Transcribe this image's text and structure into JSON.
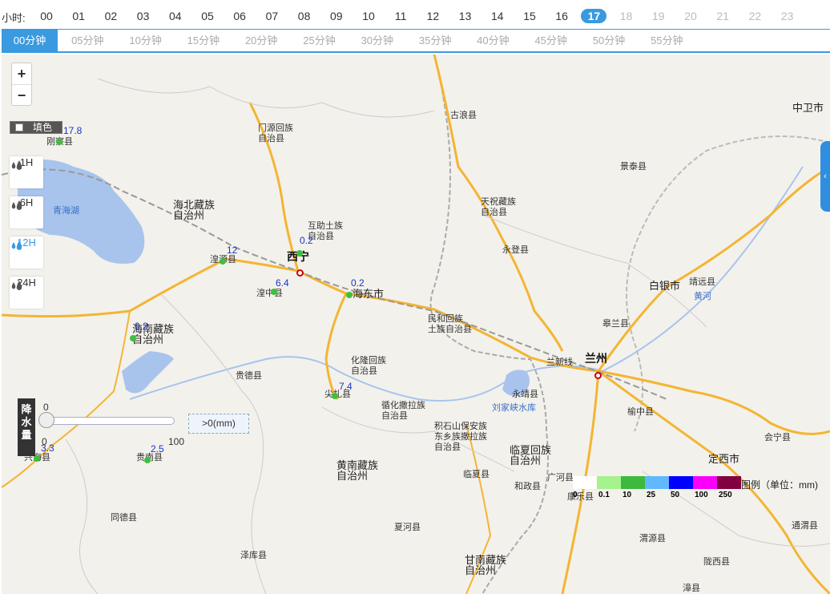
{
  "hour_bar": {
    "label": "小时:",
    "hours": [
      "00",
      "01",
      "02",
      "03",
      "04",
      "05",
      "06",
      "07",
      "08",
      "09",
      "10",
      "11",
      "12",
      "13",
      "14",
      "15",
      "16",
      "17",
      "18",
      "19",
      "20",
      "21",
      "22",
      "23"
    ],
    "active_hour": "17"
  },
  "minute_bar": {
    "minutes": [
      "00分钟",
      "05分钟",
      "10分钟",
      "15分钟",
      "20分钟",
      "25分钟",
      "30分钟",
      "35分钟",
      "40分钟",
      "45分钟",
      "50分钟",
      "55分钟"
    ],
    "active_minute": "00分钟"
  },
  "zoom": {
    "in": "+",
    "out": "−"
  },
  "fill_toggle": {
    "label": "填色",
    "checked": false
  },
  "periods": [
    {
      "label": "1H",
      "active": false
    },
    {
      "label": "6H",
      "active": false
    },
    {
      "label": "12H",
      "active": true
    },
    {
      "label": "24H",
      "active": false
    }
  ],
  "precip_slider": {
    "title": "降水量",
    "min_label": "0",
    "zero_label": "0",
    "max_label": "100",
    "readout": ">0(mm)",
    "value_fraction": 0
  },
  "legend": {
    "title": "图例（单位：mm)",
    "stops": [
      {
        "label": "0",
        "color": "#ffffff"
      },
      {
        "label": "0.1",
        "color": "#a6f28f"
      },
      {
        "label": "10",
        "color": "#3dba3d"
      },
      {
        "label": "25",
        "color": "#61b8ff"
      },
      {
        "label": "50",
        "color": "#0000ff"
      },
      {
        "label": "100",
        "color": "#fa00fa"
      },
      {
        "label": "250",
        "color": "#800040"
      }
    ]
  },
  "map": {
    "lake_label": "青海湖",
    "places": [
      {
        "name": "古浪县",
        "cls": "place"
      },
      {
        "name": "中卫市",
        "cls": "place big"
      },
      {
        "name": "门源回族\n自治县",
        "cls": "place"
      },
      {
        "name": "景泰县",
        "cls": "place"
      },
      {
        "name": "刚察县",
        "cls": "place"
      },
      {
        "name": "天祝藏族\n自治县",
        "cls": "place"
      },
      {
        "name": "海北藏族\n自治州",
        "cls": "place big"
      },
      {
        "name": "互助土族\n自治县",
        "cls": "place"
      },
      {
        "name": "永登县",
        "cls": "place"
      },
      {
        "name": "西宁",
        "cls": "place city"
      },
      {
        "name": "湟源县",
        "cls": "place"
      },
      {
        "name": "白银市",
        "cls": "place big"
      },
      {
        "name": "靖远县",
        "cls": "place"
      },
      {
        "name": "湟中县",
        "cls": "place"
      },
      {
        "name": "海东市",
        "cls": "place big"
      },
      {
        "name": "黄河",
        "cls": "place water"
      },
      {
        "name": "民和回族\n土族自治县",
        "cls": "place"
      },
      {
        "name": "皋兰县",
        "cls": "place"
      },
      {
        "name": "海南藏族\n自治州",
        "cls": "place big"
      },
      {
        "name": "兰州",
        "cls": "place city"
      },
      {
        "name": "兰新线",
        "cls": "place"
      },
      {
        "name": "化隆回族\n自治县",
        "cls": "place"
      },
      {
        "name": "贵德县",
        "cls": "place"
      },
      {
        "name": "尖扎县",
        "cls": "place"
      },
      {
        "name": "永靖县",
        "cls": "place"
      },
      {
        "name": "循化撒拉族\n自治县",
        "cls": "place"
      },
      {
        "name": "刘家峡水库",
        "cls": "place water"
      },
      {
        "name": "榆中县",
        "cls": "place"
      },
      {
        "name": "积石山保安族\n东乡族撒拉族\n自治县",
        "cls": "place"
      },
      {
        "name": "会宁县",
        "cls": "place"
      },
      {
        "name": "临夏回族\n自治州",
        "cls": "place big"
      },
      {
        "name": "定西市",
        "cls": "place big"
      },
      {
        "name": "兴海县",
        "cls": "place"
      },
      {
        "name": "贵南县",
        "cls": "place"
      },
      {
        "name": "黄南藏族\n自治州",
        "cls": "place big"
      },
      {
        "name": "临夏县",
        "cls": "place"
      },
      {
        "name": "广河县",
        "cls": "place"
      },
      {
        "name": "和政县",
        "cls": "place"
      },
      {
        "name": "康乐县",
        "cls": "place"
      },
      {
        "name": "同德县",
        "cls": "place"
      },
      {
        "name": "夏河县",
        "cls": "place"
      },
      {
        "name": "通渭县",
        "cls": "place"
      },
      {
        "name": "渭源县",
        "cls": "place"
      },
      {
        "name": "泽库县",
        "cls": "place"
      },
      {
        "name": "甘南藏族\n自治州",
        "cls": "place big"
      },
      {
        "name": "陇西县",
        "cls": "place"
      },
      {
        "name": "漳县",
        "cls": "place"
      }
    ],
    "stations": [
      {
        "value": "17.8"
      },
      {
        "value": "12"
      },
      {
        "value": "0.2"
      },
      {
        "value": "6.4"
      },
      {
        "value": "0.2"
      },
      {
        "value": "0.2"
      },
      {
        "value": "7.4"
      },
      {
        "value": "3.3"
      },
      {
        "value": "2.5"
      }
    ]
  }
}
